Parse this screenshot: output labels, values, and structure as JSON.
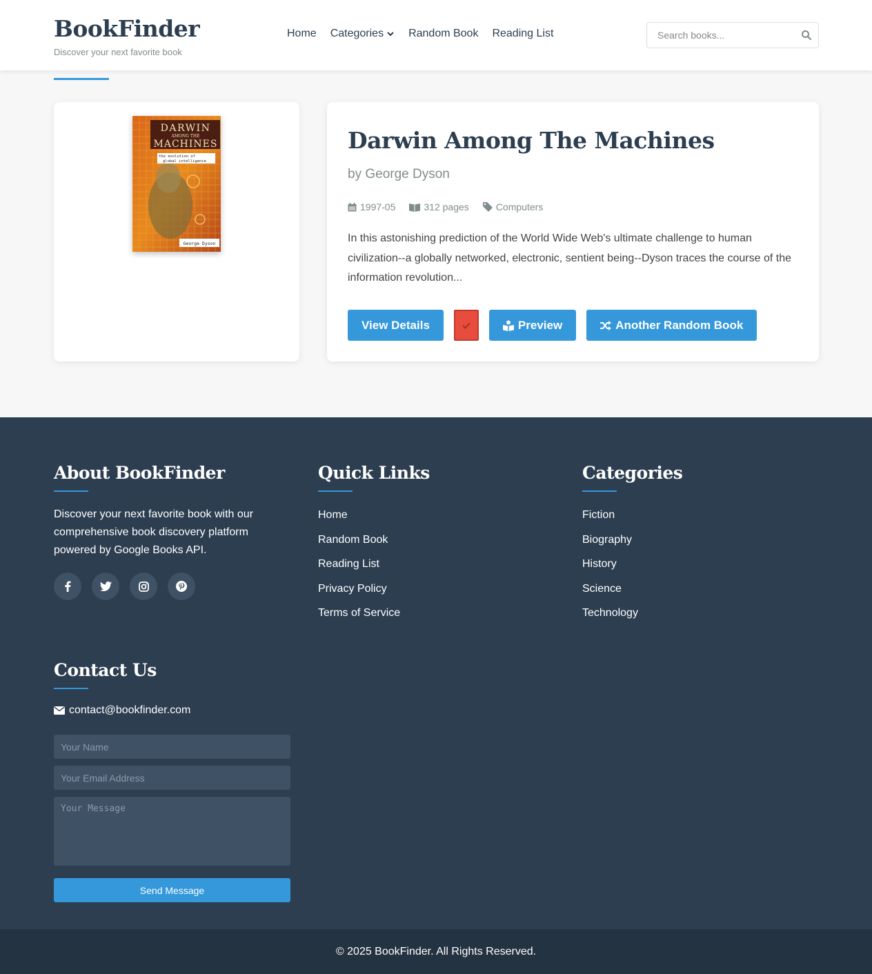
{
  "header": {
    "logo": "BookFinder",
    "tagline": "Discover your next favorite book",
    "nav": [
      "Home",
      "Categories",
      "Random Book",
      "Reading List"
    ],
    "search_placeholder": "Search books..."
  },
  "book": {
    "cover": {
      "title_line1": "DARWIN",
      "title_line2": "AMONG THE",
      "title_line3": "MACHINES",
      "subtitle_line1": "the evolution of",
      "subtitle_line2": "global intelligence",
      "author": "George Dyson"
    },
    "title": "Darwin Among The Machines",
    "author": "by George Dyson",
    "published": "1997-05",
    "pages": "312 pages",
    "category": "Computers",
    "description": "In this astonishing prediction of the World Wide Web's ultimate challenge to human civilization--a globally networked, electronic, sentient being--Dyson traces the course of the information revolution..."
  },
  "actions": {
    "view_details": "View Details",
    "preview": "Preview",
    "random": "Another Random Book"
  },
  "footer": {
    "about_heading": "About BookFinder",
    "about_text": "Discover your next favorite book with our comprehensive book discovery platform powered by Google Books API.",
    "quick_links_heading": "Quick Links",
    "quick_links": [
      "Home",
      "Random Book",
      "Reading List",
      "Privacy Policy",
      "Terms of Service"
    ],
    "categories_heading": "Categories",
    "categories": [
      "Fiction",
      "Biography",
      "History",
      "Science",
      "Technology"
    ],
    "contact_heading": "Contact Us",
    "contact_email": "contact@bookfinder.com",
    "name_placeholder": "Your Name",
    "email_placeholder": "Your Email Address",
    "message_placeholder": "Your Message",
    "send_label": "Send Message",
    "social_icons": [
      "facebook-icon",
      "twitter-icon",
      "instagram-icon",
      "pinterest-icon"
    ],
    "copyright": "© 2025 BookFinder. All Rights Reserved."
  },
  "colors": {
    "primary": "#3498db",
    "dark": "#2c3e50",
    "danger": "#e74c3c"
  }
}
